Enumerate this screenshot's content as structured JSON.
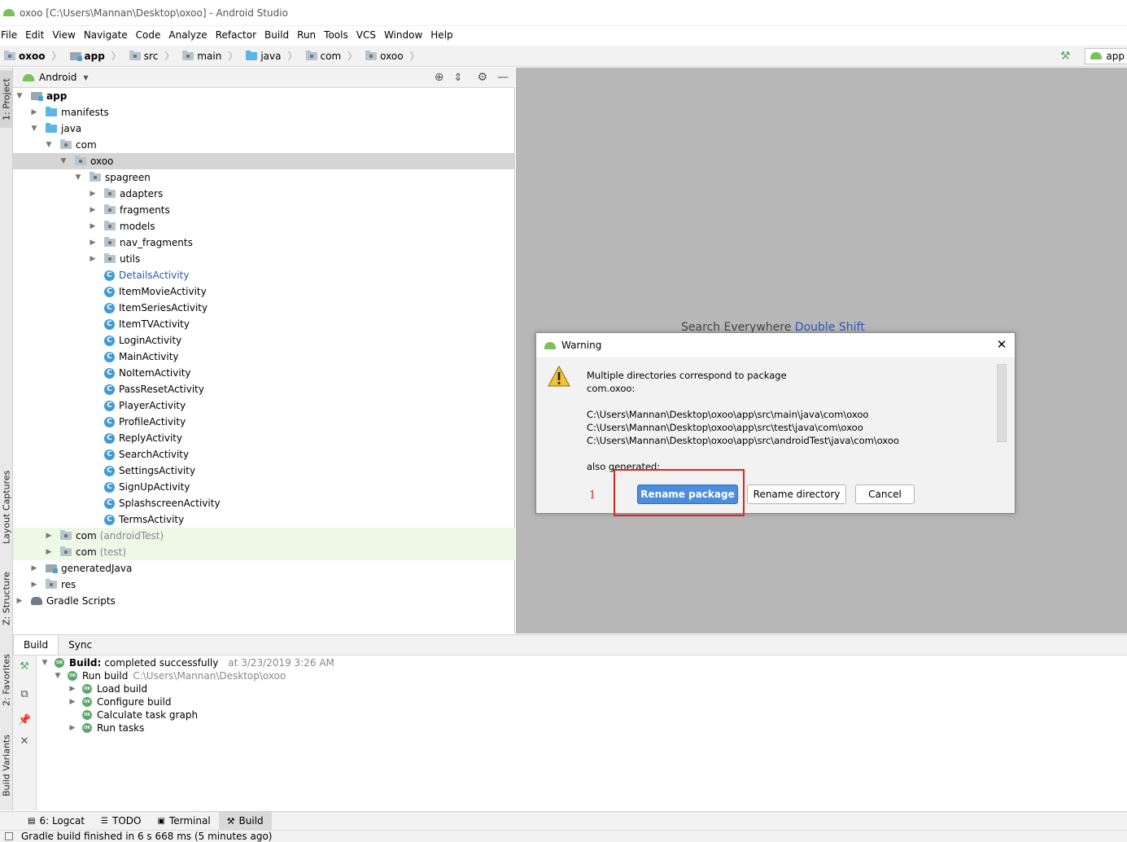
{
  "window": {
    "title": "oxoo [C:\\Users\\Mannan\\Desktop\\oxoo] - Android Studio"
  },
  "menu": [
    "File",
    "Edit",
    "View",
    "Navigate",
    "Code",
    "Analyze",
    "Refactor",
    "Build",
    "Run",
    "Tools",
    "VCS",
    "Window",
    "Help"
  ],
  "breadcrumbs": [
    "oxoo",
    "app",
    "src",
    "main",
    "java",
    "com",
    "oxoo"
  ],
  "run_config": "app",
  "side_tabs": {
    "project": "1: Project",
    "layout_captures": "Layout Captures",
    "structure": "Z: Structure",
    "favorites": "2: Favorites",
    "build_variants": "Build Variants"
  },
  "project_panel": {
    "view_mode": "Android"
  },
  "tree": {
    "app": "app",
    "manifests": "manifests",
    "java": "java",
    "com": "com",
    "oxoo": "oxoo",
    "spagreen": "spagreen",
    "adapters": "adapters",
    "fragments": "fragments",
    "models": "models",
    "nav_fragments": "nav_fragments",
    "utils": "utils",
    "classes": [
      "DetailsActivity",
      "ItemMovieActivity",
      "ItemSeriesActivity",
      "ItemTVActivity",
      "LoginActivity",
      "MainActivity",
      "NoItemActivity",
      "PassResetActivity",
      "PlayerActivity",
      "ProfileActivity",
      "ReplyActivity",
      "SearchActivity",
      "SettingsActivity",
      "SignUpActivity",
      "SplashscreenActivity",
      "TermsActivity"
    ],
    "com_android_test": "com",
    "android_test_suffix": "(androidTest)",
    "com_test": "com",
    "test_suffix": "(test)",
    "generated_java": "generatedJava",
    "res": "res",
    "gradle_scripts": "Gradle Scripts"
  },
  "editor": {
    "hint_text": "Search Everywhere",
    "hint_key": "Double Shift"
  },
  "dialog": {
    "title": "Warning",
    "lines": [
      "Multiple directories correspond to package",
      "com.oxoo:",
      "",
      "C:\\Users\\Mannan\\Desktop\\oxoo\\app\\src\\main\\java\\com\\oxoo",
      "C:\\Users\\Mannan\\Desktop\\oxoo\\app\\src\\test\\java\\com\\oxoo",
      "C:\\Users\\Mannan\\Desktop\\oxoo\\app\\src\\androidTest\\java\\com\\oxoo",
      "",
      "also generated:"
    ],
    "buttons": {
      "rename_package": "Rename package",
      "rename_directory": "Rename directory",
      "cancel": "Cancel"
    },
    "annotation_number": "1"
  },
  "build_panel": {
    "tabs": [
      "Build",
      "Sync"
    ],
    "status_bold": "Build:",
    "status": "completed successfully",
    "timestamp": "at 3/23/2019 3:26 AM",
    "run_build": "Run build",
    "run_build_path": "C:\\Users\\Mannan\\Desktop\\oxoo",
    "steps": [
      "Load build",
      "Configure build",
      "Calculate task graph",
      "Run tasks"
    ],
    "ok_badge": "OK"
  },
  "tool_tabs": [
    "6: Logcat",
    "TODO",
    "Terminal",
    "Build"
  ],
  "status_bar": "Gradle build finished in 6 s 668 ms (5 minutes ago)",
  "colors": {
    "accent": "#4c8de0",
    "highlight": "#e0251b",
    "android_green": "#78c257",
    "folder_blue": "#5cb5e6"
  }
}
